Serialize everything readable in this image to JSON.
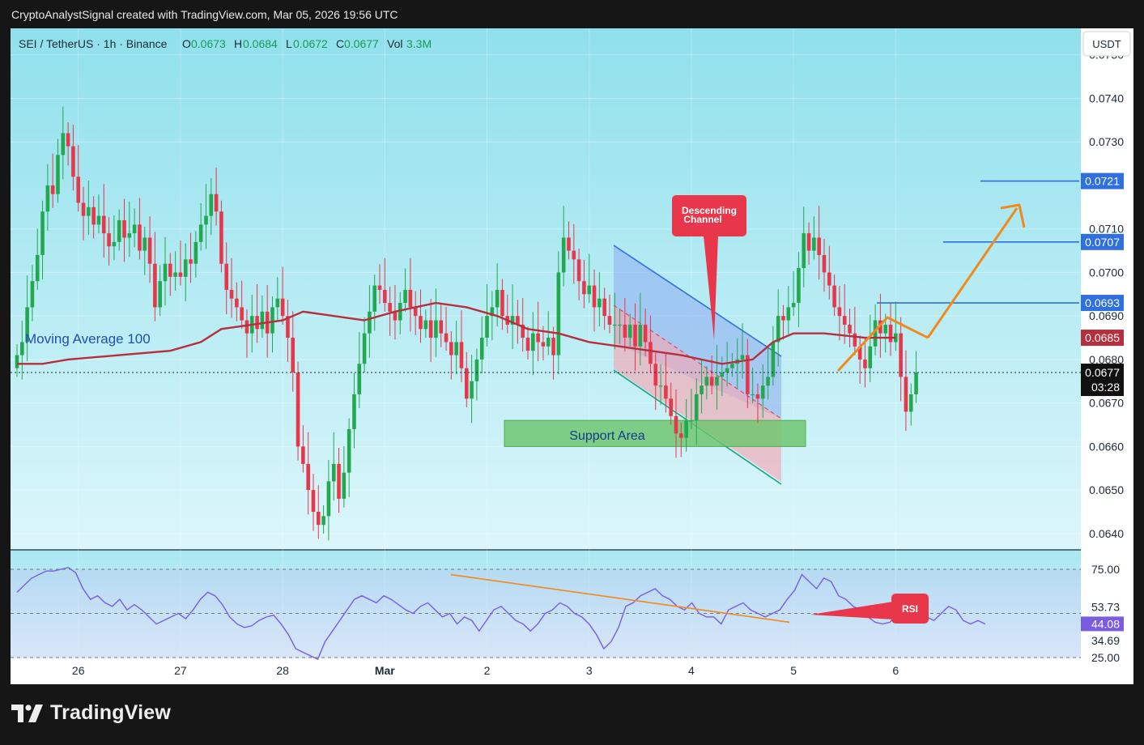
{
  "caption": "CryptoAnalystSignal created with TradingView.com, Mar 05, 2026 19:56 UTC",
  "brand": "TradingView",
  "icons": {
    "brand_logo": "tradingview-logo-icon"
  },
  "colors": {
    "up": "#22a84f",
    "down": "#e8364a",
    "ma": "#b5303c",
    "background_top": "#8fe0ec",
    "background_bottom": "#dcf6fb",
    "blue_line": "#2f6fe0",
    "orange": "#f08a1c",
    "rsi": "#7a5ce0"
  },
  "header": {
    "symbol": "SEI / TetherUS · 1h · Binance",
    "open_label": "O",
    "open": "0.0673",
    "high_label": "H",
    "high": "0.0684",
    "low_label": "L",
    "low": "0.0672",
    "close_label": "C",
    "close": "0.0677",
    "vol_label": "Vol",
    "vol": "3.3M"
  },
  "currency": "USDT",
  "chart_data": {
    "type": "candlestick",
    "symbol": "SEI / TetherUS",
    "interval": "1h",
    "exchange": "Binance",
    "y_range": [
      0.0637,
      0.0752
    ],
    "y_ticks": [
      "0.0750",
      "0.0740",
      "0.0730",
      "0.0710",
      "0.0700",
      "0.0690",
      "0.0680",
      "0.0670",
      "0.0660",
      "0.0650",
      "0.0640"
    ],
    "x_ticks": [
      "26",
      "27",
      "28",
      "Mar",
      "2",
      "3",
      "4",
      "5",
      "6"
    ],
    "x_range": [
      0,
      184
    ],
    "x_tick_positions": [
      12,
      32,
      52,
      72,
      92,
      112,
      132,
      152,
      172
    ],
    "price_badges": [
      {
        "value": "0.0721",
        "color": "#2f6fe0"
      },
      {
        "value": "0.0707",
        "color": "#2f6fe0"
      },
      {
        "value": "0.0693",
        "color": "#2f6fe0"
      },
      {
        "value": "0.0685",
        "color": "#b5303c"
      }
    ],
    "last_price": "0.0677",
    "countdown": "03:28",
    "closes": [
      0.0681,
      0.0684,
      0.0692,
      0.0698,
      0.0704,
      0.0714,
      0.072,
      0.0718,
      0.0727,
      0.0732,
      0.0729,
      0.0722,
      0.0716,
      0.0713,
      0.0715,
      0.0711,
      0.0713,
      0.0709,
      0.0706,
      0.0707,
      0.0712,
      0.0708,
      0.0709,
      0.0711,
      0.0705,
      0.0708,
      0.0702,
      0.0692,
      0.0698,
      0.0702,
      0.0699,
      0.07,
      0.0699,
      0.0703,
      0.0702,
      0.0707,
      0.0711,
      0.0713,
      0.0718,
      0.0714,
      0.0702,
      0.0696,
      0.0694,
      0.0692,
      0.0689,
      0.0686,
      0.069,
      0.0687,
      0.0691,
      0.0686,
      0.0692,
      0.0694,
      0.069,
      0.0685,
      0.0677,
      0.066,
      0.0656,
      0.065,
      0.0645,
      0.0642,
      0.0644,
      0.0652,
      0.0656,
      0.0648,
      0.0654,
      0.0664,
      0.0672,
      0.0679,
      0.0686,
      0.0691,
      0.0697,
      0.0696,
      0.0693,
      0.0691,
      0.0689,
      0.0693,
      0.0696,
      0.0692,
      0.069,
      0.0687,
      0.0689,
      0.0685,
      0.0689,
      0.0686,
      0.0684,
      0.0681,
      0.0684,
      0.0678,
      0.0671,
      0.0675,
      0.068,
      0.0685,
      0.069,
      0.0692,
      0.0696,
      0.069,
      0.0688,
      0.069,
      0.0688,
      0.0685,
      0.0682,
      0.0686,
      0.0684,
      0.0683,
      0.0685,
      0.0681,
      0.07,
      0.0708,
      0.0705,
      0.0703,
      0.0698,
      0.0695,
      0.0697,
      0.0692,
      0.0694,
      0.069,
      0.0688,
      0.0688,
      0.0688,
      0.0685,
      0.0688,
      0.0683,
      0.0688,
      0.0684,
      0.0679,
      0.0674,
      0.0674,
      0.0671,
      0.0667,
      0.0663,
      0.0662,
      0.0666,
      0.0666,
      0.0672,
      0.0674,
      0.0676,
      0.0674,
      0.0676,
      0.0677,
      0.0678,
      0.0679,
      0.068,
      0.0681,
      0.0672,
      0.0672,
      0.0671,
      0.0674,
      0.0676,
      0.0684,
      0.069,
      0.0689,
      0.0692,
      0.0693,
      0.0701,
      0.0709,
      0.0705,
      0.0708,
      0.0704,
      0.07,
      0.0697,
      0.0692,
      0.069,
      0.0688,
      0.0686,
      0.0683,
      0.068,
      0.0678,
      0.0683,
      0.0689,
      0.0686,
      0.0688,
      0.0684,
      0.0686,
      0.0676,
      0.0668,
      0.0672,
      0.0677
    ],
    "ma_label": "Moving Average 100",
    "ma_points": [
      [
        0,
        0.0679
      ],
      [
        5,
        0.0679
      ],
      [
        10,
        0.068
      ],
      [
        20,
        0.0681
      ],
      [
        30,
        0.0682
      ],
      [
        36,
        0.0684
      ],
      [
        40,
        0.0687
      ],
      [
        46,
        0.0688
      ],
      [
        52,
        0.0689
      ],
      [
        56,
        0.0691
      ],
      [
        62,
        0.069
      ],
      [
        68,
        0.0689
      ],
      [
        74,
        0.0691
      ],
      [
        82,
        0.0693
      ],
      [
        88,
        0.0692
      ],
      [
        94,
        0.069
      ],
      [
        100,
        0.0687
      ],
      [
        106,
        0.0686
      ],
      [
        112,
        0.0684
      ],
      [
        118,
        0.0683
      ],
      [
        124,
        0.0682
      ],
      [
        130,
        0.0681
      ],
      [
        138,
        0.0679
      ],
      [
        144,
        0.068
      ],
      [
        148,
        0.0684
      ],
      [
        152,
        0.0686
      ],
      [
        158,
        0.0686
      ],
      [
        166,
        0.0685
      ],
      [
        172,
        0.0685
      ]
    ],
    "annotations": {
      "channel_label": "Descending Channel",
      "support_label": "Support Area",
      "ma_label": "Moving Average 100",
      "rsi_label": "RSI"
    },
    "rsi": {
      "levels": [
        "75.00",
        "53.73",
        "44.08",
        "34.69",
        "25.00"
      ],
      "current": "44.08",
      "values": [
        62,
        66,
        70,
        72,
        74,
        74,
        75,
        76,
        73,
        64,
        58,
        60,
        56,
        54,
        58,
        52,
        55,
        52,
        48,
        44,
        46,
        48,
        50,
        47,
        52,
        58,
        62,
        60,
        55,
        48,
        44,
        42,
        43,
        46,
        48,
        49,
        44,
        38,
        30,
        28,
        26,
        24,
        34,
        40,
        46,
        52,
        58,
        60,
        58,
        56,
        60,
        58,
        55,
        52,
        50,
        54,
        56,
        52,
        48,
        50,
        44,
        48,
        46,
        40,
        46,
        52,
        54,
        50,
        46,
        44,
        40,
        44,
        50,
        52,
        56,
        54,
        50,
        48,
        44,
        38,
        30,
        34,
        42,
        54,
        56,
        60,
        62,
        64,
        60,
        58,
        54,
        52,
        56,
        50,
        48,
        48,
        44,
        52,
        54,
        56,
        52,
        50,
        48,
        50,
        52,
        58,
        63,
        72,
        68,
        64,
        70,
        68,
        60,
        58,
        54,
        52,
        48,
        45,
        44,
        45,
        50,
        54,
        56,
        52,
        48,
        46,
        50,
        54,
        52,
        46,
        44,
        46,
        44
      ],
      "trend_line": [
        [
          38,
          72
        ],
        [
          75,
          45
        ]
      ]
    }
  }
}
